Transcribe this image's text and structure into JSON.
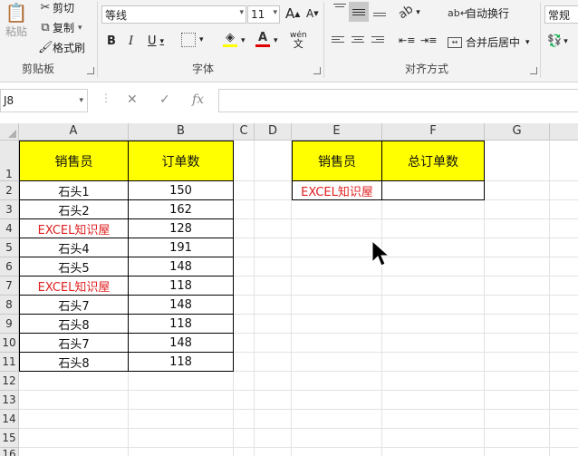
{
  "ribbon": {
    "clipboard": {
      "paste": "粘贴",
      "cut": "剪切",
      "copy": "复制",
      "format_painter": "格式刷",
      "label": "剪贴板"
    },
    "font": {
      "name": "等线",
      "size": "11",
      "label": "字体",
      "bold": "B",
      "italic": "I",
      "underline": "U",
      "grow": "A",
      "shrink": "A",
      "pinyin": "wén"
    },
    "alignment": {
      "wrap": "自动换行",
      "merge": "合并后居中",
      "label": "对齐方式"
    },
    "number": {
      "format": "常规"
    }
  },
  "formula_bar": {
    "name_box": "J8",
    "fx": "fx",
    "value": ""
  },
  "columns": [
    "A",
    "B",
    "C",
    "D",
    "E",
    "F",
    "G"
  ],
  "rows": [
    "1",
    "2",
    "3",
    "4",
    "5",
    "6",
    "7",
    "8",
    "9",
    "10",
    "11",
    "12",
    "13",
    "14",
    "15",
    "16"
  ],
  "table1": {
    "headers": [
      "销售员",
      "订单数"
    ],
    "rows": [
      {
        "name": "石头1",
        "orders": "150",
        "highlight": false
      },
      {
        "name": "石头2",
        "orders": "162",
        "highlight": false
      },
      {
        "name": "EXCEL知识屋",
        "orders": "128",
        "highlight": true
      },
      {
        "name": "石头4",
        "orders": "191",
        "highlight": false
      },
      {
        "name": "石头5",
        "orders": "148",
        "highlight": false
      },
      {
        "name": "EXCEL知识屋",
        "orders": "118",
        "highlight": true
      },
      {
        "name": "石头7",
        "orders": "148",
        "highlight": false
      },
      {
        "name": "石头8",
        "orders": "118",
        "highlight": false
      },
      {
        "name": "石头7",
        "orders": "148",
        "highlight": false
      },
      {
        "name": "石头8",
        "orders": "118",
        "highlight": false
      }
    ]
  },
  "table2": {
    "headers": [
      "销售员",
      "总订单数"
    ],
    "row": {
      "name": "EXCEL知识屋",
      "total": ""
    }
  },
  "colors": {
    "header_fill": "#ffff00",
    "highlight_text": "#e02020"
  }
}
